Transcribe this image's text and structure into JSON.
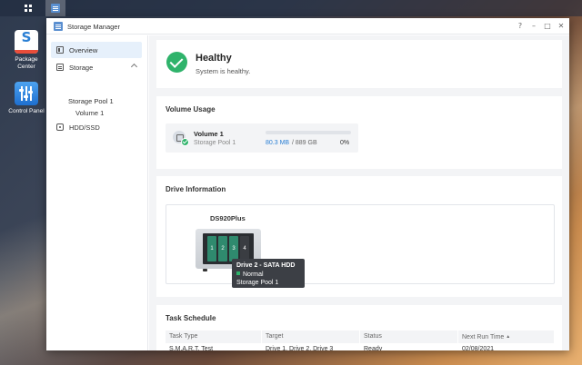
{
  "desktop": {
    "icons": [
      {
        "label": "Package Center"
      },
      {
        "label": "Control Panel"
      }
    ]
  },
  "window": {
    "title": "Storage Manager",
    "controls": {
      "help": "?",
      "minimize": "–",
      "maximize": "□",
      "close": "✕"
    }
  },
  "sidebar": {
    "items": [
      {
        "label": "Overview",
        "icon": "overview-icon",
        "active": true
      },
      {
        "label": "Storage",
        "icon": "storage-icon"
      },
      {
        "label": "Storage Pool 1"
      },
      {
        "label": "Volume 1"
      },
      {
        "label": "HDD/SSD",
        "icon": "hdd-icon"
      }
    ]
  },
  "health": {
    "status": "Healthy",
    "message": "System is healthy.",
    "color": "#2fb36b"
  },
  "volume_usage": {
    "title": "Volume Usage",
    "volume_name": "Volume 1",
    "pool_name": "Storage Pool 1",
    "used": "80.3 MB",
    "total": "/ 889 GB",
    "percent": "0%",
    "usage_fraction": 0.0
  },
  "drive_info": {
    "title": "Drive Information",
    "model": "DS920Plus",
    "bays": [
      "1",
      "2",
      "3",
      "4"
    ],
    "tooltip": {
      "title": "Drive 2 - SATA HDD",
      "status": "Normal",
      "pool": "Storage Pool 1"
    }
  },
  "task_schedule": {
    "title": "Task Schedule",
    "columns": [
      "Task Type",
      "Target",
      "Status",
      "Next Run Time"
    ],
    "rows": [
      [
        "S.M.A.R.T. Test",
        "Drive 1, Drive 2, Drive 3",
        "Ready",
        "02/08/2021"
      ]
    ]
  },
  "colors": {
    "accent": "#2a7fd4",
    "healthy": "#2fb36b",
    "active_nav_bg": "#e6f0fb"
  }
}
